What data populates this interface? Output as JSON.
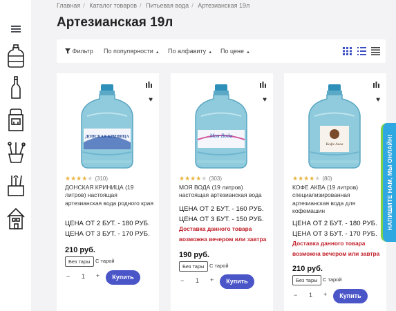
{
  "breadcrumb": [
    "Главная",
    "Каталог товаров",
    "Питьевая вода",
    "Артезианская 19л"
  ],
  "page_title": "Артезианская 19л",
  "toolbar": {
    "filter": "Фильтр",
    "sort_popularity": "По популярности",
    "sort_alpha": "По алфавиту",
    "sort_price": "По цене"
  },
  "sidebar": {
    "categories": [
      "water-bottle-icon",
      "glass-bottle-icon",
      "water-cooler-icon",
      "accessories-icon",
      "kitchen-utensils-icon",
      "house-icon"
    ]
  },
  "products": [
    {
      "label_text": "ДОНСКАЯ КРИНИЦА",
      "rating": 4,
      "reviews": "(310)",
      "name": "ДОНСКАЯ КРИНИЦА (19 литров) настоящая артезианская вода родного края",
      "price_2": "ЦЕНА ОТ 2 БУТ. - 180 РУБ.",
      "price_3": "ЦЕНА ОТ 3 БУТ. - 170 РУБ.",
      "promo": "",
      "price": "210 руб.",
      "option_1": "Без тары",
      "option_2": "С тарой",
      "qty": "1",
      "buy": "Купить"
    },
    {
      "label_text": "Моя Вода",
      "rating": 4,
      "reviews": "(303)",
      "name": "МОЯ ВОДА (19 литров) настоящая артезианская вода",
      "price_2": "ЦЕНА ОТ 2 БУТ. - 160 РУБ.",
      "price_3": "ЦЕНА ОТ 3 БУТ. - 150 РУБ.",
      "promo": "Доставка данного товара возможна вечером или завтра",
      "price": "190 руб.",
      "option_1": "Без тары",
      "option_2": "С тарой",
      "qty": "1",
      "buy": "Купить"
    },
    {
      "label_text": "Кофе Аква",
      "rating": 4,
      "reviews": "(80)",
      "name": "КОФЕ АКВА (19 литров) специализированная артезианская вода для кофемашин",
      "price_2": "ЦЕНА ОТ 2 БУТ. - 180 РУБ.",
      "price_3": "ЦЕНА ОТ 3 БУТ. - 170 РУБ.",
      "promo": "Доставка данного товара возможна вечером или завтра",
      "price": "210 руб.",
      "option_1": "Без тары",
      "option_2": "С тарой",
      "qty": "1",
      "buy": "Купить"
    }
  ],
  "chat_tab": "НАПИШИТЕ НАМ, МЫ ОНЛАЙН!",
  "colors": {
    "accent": "#4a55c8",
    "promo": "#c0202a",
    "star": "#e8b23a",
    "chat": "#2fa7e0"
  }
}
